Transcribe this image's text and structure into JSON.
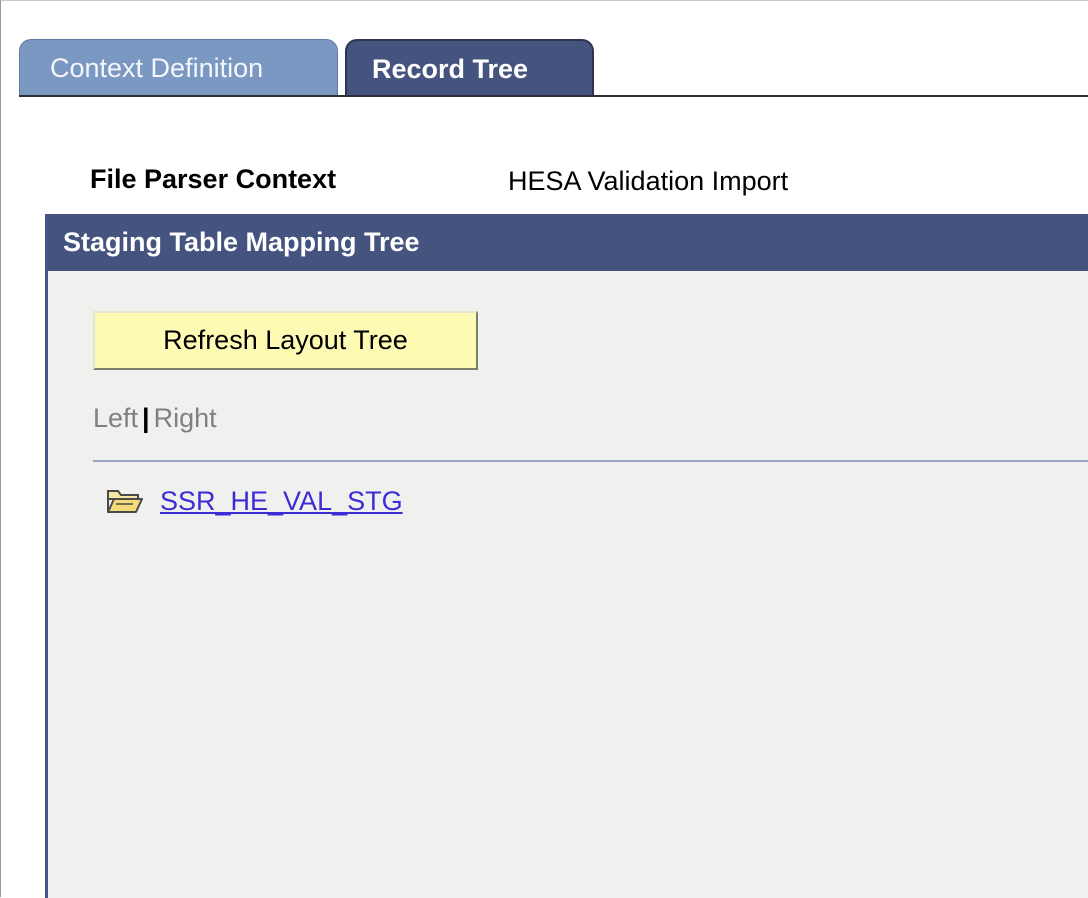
{
  "tabs": [
    {
      "label": "Context Definition",
      "active": false
    },
    {
      "label": "Record Tree",
      "active": true
    }
  ],
  "context": {
    "label": "File Parser Context",
    "value": "HESA Validation Import"
  },
  "panel": {
    "title": "Staging Table Mapping Tree",
    "refresh_button_label": "Refresh Layout Tree",
    "left_label": "Left",
    "separator": "|",
    "right_label": "Right",
    "tree_items": [
      {
        "label": "SSR_HE_VAL_STG",
        "icon": "open-folder-icon"
      }
    ]
  },
  "colors": {
    "header_bg": "#45537f",
    "inactive_tab_bg": "#7a98c2",
    "panel_bg": "#f0f1ee",
    "button_bg": "#fdfab3",
    "link": "#3b2cd6"
  }
}
